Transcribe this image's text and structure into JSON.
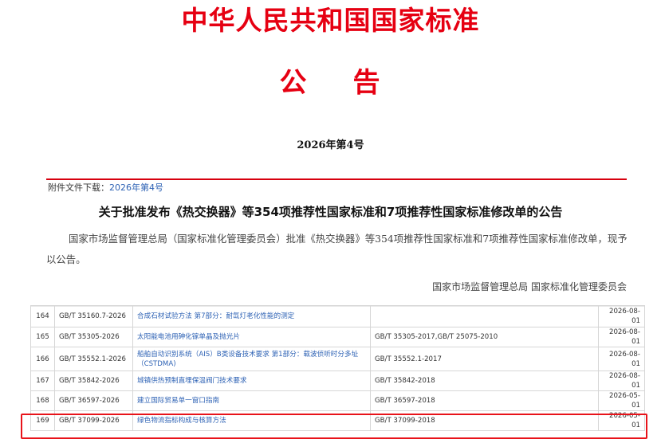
{
  "header": {
    "main_title": "中华人民共和国国家标准",
    "sub_title_1": "公",
    "sub_title_2": "告",
    "issue_no": "2026年第4号"
  },
  "attachment": {
    "label": "附件文件下载：",
    "link_text": "2026年第4号"
  },
  "notice": {
    "title": "关于批准发布《热交换器》等354项推荐性国家标准和7项推荐性国家标准修改单的公告",
    "body": "国家市场监督管理总局（国家标准化管理委员会）批准《热交换器》等354项推荐性国家标准和7项推荐性国家标准修改单，现予以公告。",
    "signature": "国家市场监督管理总局 国家标准化管理委员会"
  },
  "table": {
    "rows": [
      {
        "no": "164",
        "code": "GB/T 35160.7-2026",
        "name": "合成石材试验方法 第7部分：耐氙灯老化性能的测定",
        "replaces": "",
        "date": "2026-08-01"
      },
      {
        "no": "165",
        "code": "GB/T 35305-2026",
        "name": "太阳能电池用砷化镓单晶及抛光片",
        "replaces": "GB/T 35305-2017,GB/T 25075-2010",
        "date": "2026-08-01"
      },
      {
        "no": "166",
        "code": "GB/T 35552.1-2026",
        "name": "船舶自动识别系统（AIS）B类设备技术要求 第1部分：载波侦听时分多址（CSTDMA)",
        "replaces": "GB/T 35552.1-2017",
        "date": "2026-08-01"
      },
      {
        "no": "167",
        "code": "GB/T 35842-2026",
        "name": "城镇供热预制直埋保温阀门技术要求",
        "replaces": "GB/T 35842-2018",
        "date": "2026-08-01"
      },
      {
        "no": "168",
        "code": "GB/T 36597-2026",
        "name": "建立国际贸易单一窗口指南",
        "replaces": "GB/T 36597-2018",
        "date": "2026-05-01"
      },
      {
        "no": "169",
        "code": "GB/T 37099-2026",
        "name": "绿色物流指标构成与核算方法",
        "replaces": "GB/T 37099-2018",
        "date": "2026-05-01"
      }
    ]
  },
  "colors": {
    "title_red": "#e60012",
    "link_blue": "#2f63b5",
    "highlight_red": "#e8131a"
  }
}
